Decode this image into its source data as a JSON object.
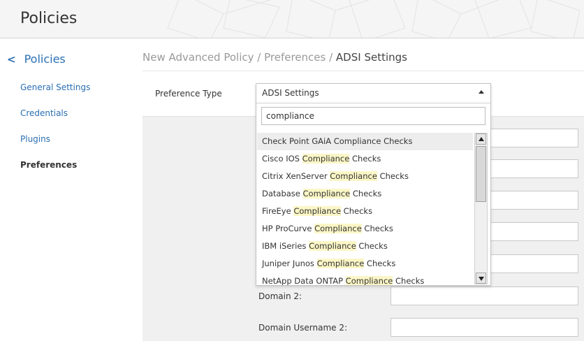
{
  "app": {
    "title": "Policies"
  },
  "sidebar": {
    "back_label": "Policies",
    "items": [
      {
        "label": "General Settings"
      },
      {
        "label": "Credentials"
      },
      {
        "label": "Plugins"
      },
      {
        "label": "Preferences",
        "active": true
      }
    ]
  },
  "breadcrumb": {
    "part1": "New Advanced Policy",
    "sep": " / ",
    "part2": "Preferences",
    "current": "ADSI Settings"
  },
  "preference": {
    "label": "Preference Type",
    "selected": "ADSI Settings",
    "search_value": "compliance"
  },
  "dropdown_items": [
    {
      "before": "Check Point GAiA Compliance Checks",
      "match": "",
      "after": ""
    },
    {
      "before": "Cisco IOS ",
      "match": "Compliance",
      "after": " Checks"
    },
    {
      "before": "Citrix XenServer ",
      "match": "Compliance",
      "after": " Checks"
    },
    {
      "before": "Database ",
      "match": "Compliance",
      "after": " Checks"
    },
    {
      "before": "FireEye ",
      "match": "Compliance",
      "after": " Checks"
    },
    {
      "before": "HP ProCurve ",
      "match": "Compliance",
      "after": " Checks"
    },
    {
      "before": "IBM iSeries ",
      "match": "Compliance",
      "after": " Checks"
    },
    {
      "before": "Juniper Junos ",
      "match": "Compliance",
      "after": " Checks"
    },
    {
      "before": "NetApp Data ONTAP ",
      "match": "Compliance",
      "after": " Checks"
    }
  ],
  "form": {
    "domain2_label": "Domain 2:",
    "domain_username2_label": "Domain Username 2:"
  },
  "colors": {
    "link": "#2a6fb3",
    "highlight": "#fbf6c6"
  }
}
